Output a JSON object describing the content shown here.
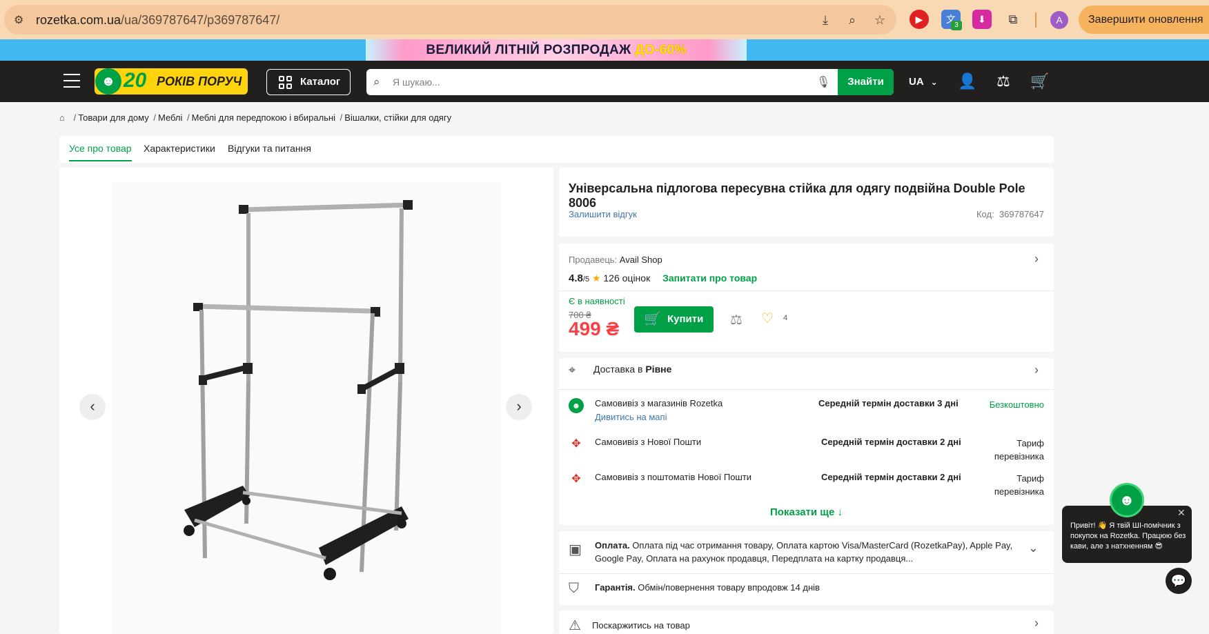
{
  "browser": {
    "url_host": "rozetka.com.ua",
    "url_path": "/ua/369787647/p369787647/",
    "ext_badge": "3",
    "profile_initial": "A",
    "update_label": "Завершити оновлення"
  },
  "banner": {
    "text_main": "ВЕЛИКИЙ ЛІТНІЙ РОЗПРОДАЖ",
    "text_accent": "ДО-60%"
  },
  "header": {
    "logo_years": "20",
    "logo_text": "РОКІВ ПОРУЧ",
    "catalog_label": "Каталог",
    "search_placeholder": "Я шукаю...",
    "search_button": "Знайти",
    "lang": "UA"
  },
  "breadcrumb": [
    "Товари для дому",
    "Меблі",
    "Меблі для передпокою і вбиральні",
    "Вішалки, стійки для одягу"
  ],
  "tabs": [
    "Усе про товар",
    "Характеристики",
    "Відгуки та питання"
  ],
  "product": {
    "title": "Універсальна підлогова пересувна стійка для одягу подвійна Double Pole 8006",
    "review_link": "Залишити відгук",
    "code_label": "Код:",
    "code_value": "369787647"
  },
  "seller": {
    "label": "Продавець:",
    "name": "Avail Shop",
    "rating": "4.8",
    "rating_max": "/5",
    "reviews": "126 оцінок",
    "ask_link": "Запитати про товар"
  },
  "purchase": {
    "stock": "Є в наявності",
    "old_price": "700 ₴",
    "price": "499 ₴",
    "buy_label": "Купити",
    "wishlist_count": "4"
  },
  "delivery": {
    "head_label": "Доставка в",
    "city": "Рівне",
    "options": [
      {
        "name": "Самовивіз з магазинів Rozetka",
        "map_link": "Дивитись на мапі",
        "term": "Середній термін доставки 3 дні",
        "price": "Безкоштовно"
      },
      {
        "name": "Самовивіз з Нової Пошти",
        "term": "Середній термін доставки 2 дні",
        "price_line1": "Тариф",
        "price_line2": "перевізника"
      },
      {
        "name": "Самовивіз з поштоматів Нової Пошти",
        "term": "Середній термін доставки 2 дні",
        "price_line1": "Тариф",
        "price_line2": "перевізника"
      }
    ],
    "show_more": "Показати ще ↓"
  },
  "payment": {
    "label": "Оплата.",
    "text": "Оплата під час отримання товару, Оплата картою Visa/MasterCard (RozetkaPay), Apple Pay, Google Pay, Оплата на рахунок продавця, Передплата на картку продавця..."
  },
  "warranty": {
    "label": "Гарантія.",
    "text": "Обмін/повернення товару впродовж 14 днів"
  },
  "complaint": {
    "label": "Поскаржитись на товар"
  },
  "chat": {
    "message": "Привіт! 👋 Я твій ШІ-помічник з покупок на Rozetka. Працюю без кави, але з натхненням 😎"
  }
}
